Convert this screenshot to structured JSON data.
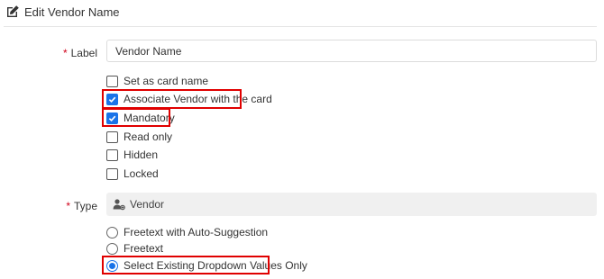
{
  "header": {
    "title": "Edit Vendor Name",
    "icon": "edit-icon"
  },
  "label_field": {
    "label": "Label",
    "value": "Vendor Name"
  },
  "checkboxes": [
    {
      "label": "Set as card name",
      "checked": false
    },
    {
      "label": "Associate Vendor with the card",
      "checked": true,
      "highlighted": true
    },
    {
      "label": "Mandatory",
      "checked": true,
      "highlighted": true
    },
    {
      "label": "Read only",
      "checked": false
    },
    {
      "label": "Hidden",
      "checked": false
    },
    {
      "label": "Locked",
      "checked": false
    }
  ],
  "type_field": {
    "label": "Type",
    "value": "Vendor",
    "icon": "vendor-user-icon"
  },
  "radios": [
    {
      "label": "Freetext with Auto-Suggestion",
      "selected": false
    },
    {
      "label": "Freetext",
      "selected": false
    },
    {
      "label": "Select Existing Dropdown Values Only",
      "selected": true,
      "highlighted": true
    }
  ],
  "colors": {
    "required": "#d0021b",
    "accent": "#1a73e8",
    "highlight": "#e00000"
  }
}
